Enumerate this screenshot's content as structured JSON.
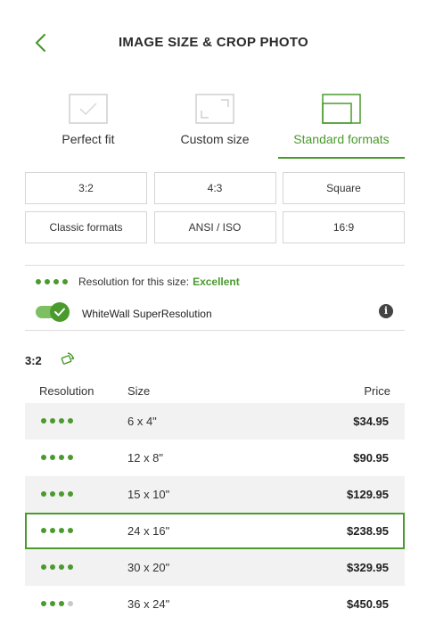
{
  "header": {
    "title": "IMAGE SIZE & CROP PHOTO"
  },
  "tabs": [
    {
      "label": "Perfect fit",
      "icon": "perfect-fit-icon",
      "active": false
    },
    {
      "label": "Custom size",
      "icon": "custom-size-icon",
      "active": false
    },
    {
      "label": "Standard formats",
      "icon": "standard-formats-icon",
      "active": true
    }
  ],
  "formats": [
    "3:2",
    "4:3",
    "Square",
    "Classic formats",
    "ANSI / ISO",
    "16:9"
  ],
  "resolution": {
    "label": "Resolution for this size:",
    "quality": "Excellent"
  },
  "superresolution": {
    "label": "WhiteWall SuperResolution",
    "enabled": true
  },
  "ratio": {
    "label": "3:2"
  },
  "table": {
    "headers": {
      "resolution": "Resolution",
      "size": "Size",
      "price": "Price"
    },
    "rows": [
      {
        "dots": 4,
        "size": "6 x 4\"",
        "price": "$34.95"
      },
      {
        "dots": 4,
        "size": "12 x 8\"",
        "price": "$90.95"
      },
      {
        "dots": 4,
        "size": "15 x 10\"",
        "price": "$129.95"
      },
      {
        "dots": 4,
        "size": "24 x 16\"",
        "price": "$238.95",
        "selected": true
      },
      {
        "dots": 4,
        "size": "30 x 20\"",
        "price": "$329.95"
      },
      {
        "dots": 3,
        "size": "36 x 24\"",
        "price": "$450.95"
      }
    ]
  },
  "colors": {
    "accent": "#4a9a2c",
    "rowStripe": "#f2f2f2",
    "border": "#d5d5d5"
  }
}
